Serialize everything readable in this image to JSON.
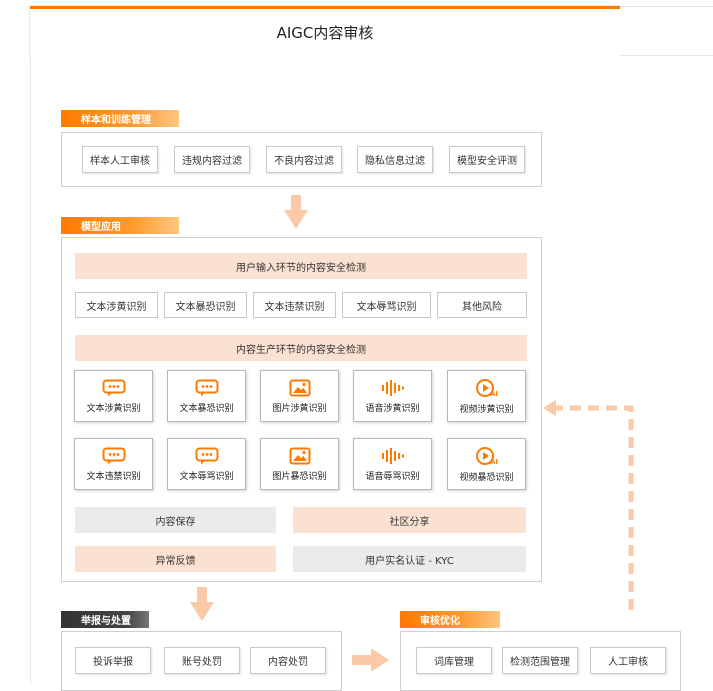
{
  "title": "AIGC内容审核",
  "sections": {
    "sample": {
      "label": "样本和训练管理",
      "items": [
        "样本人工审核",
        "违规内容过滤",
        "不良内容过滤",
        "隐私信息过滤",
        "模型安全评测"
      ]
    },
    "app": {
      "label": "模型应用",
      "input_heading": "用户输入环节的内容安全检测",
      "input_items": [
        "文本涉黄识别",
        "文本暴恐识别",
        "文本违禁识别",
        "文本辱骂识别",
        "其他风险"
      ],
      "gen_heading": "内容生产环节的内容安全检测",
      "cards_row1": [
        {
          "label": "文本涉黄识别",
          "icon": "chat-bubble-icon"
        },
        {
          "label": "文本暴恐识别",
          "icon": "chat-bubble-icon"
        },
        {
          "label": "图片涉黄识别",
          "icon": "image-icon"
        },
        {
          "label": "语音涉黄识别",
          "icon": "audio-wave-icon"
        },
        {
          "label": "视频涉黄识别",
          "icon": "ai-video-icon"
        }
      ],
      "cards_row2": [
        {
          "label": "文本违禁识别",
          "icon": "chat-bubble-icon"
        },
        {
          "label": "文本辱骂识别",
          "icon": "chat-bubble-icon"
        },
        {
          "label": "图片暴恐识别",
          "icon": "image-icon"
        },
        {
          "label": "语音辱骂识别",
          "icon": "audio-wave-icon"
        },
        {
          "label": "视频暴恐识别",
          "icon": "ai-video-icon"
        }
      ],
      "save": "内容保存",
      "share": "社区分享",
      "feedback": "异常反馈",
      "kyc": "用户实名认证 - KYC"
    },
    "report": {
      "label": "举报与处置",
      "items": [
        "投诉举报",
        "账号处罚",
        "内容处罚"
      ]
    },
    "optimize": {
      "label": "审核优化",
      "items": [
        "词库管理",
        "检测范围管理",
        "人工审核"
      ]
    }
  },
  "colors": {
    "accent": "#ff7a00",
    "peach": "#fbe1d2",
    "grey": "#ebebeb",
    "arrow": "#fac9a8"
  },
  "ai_badge": "AI"
}
